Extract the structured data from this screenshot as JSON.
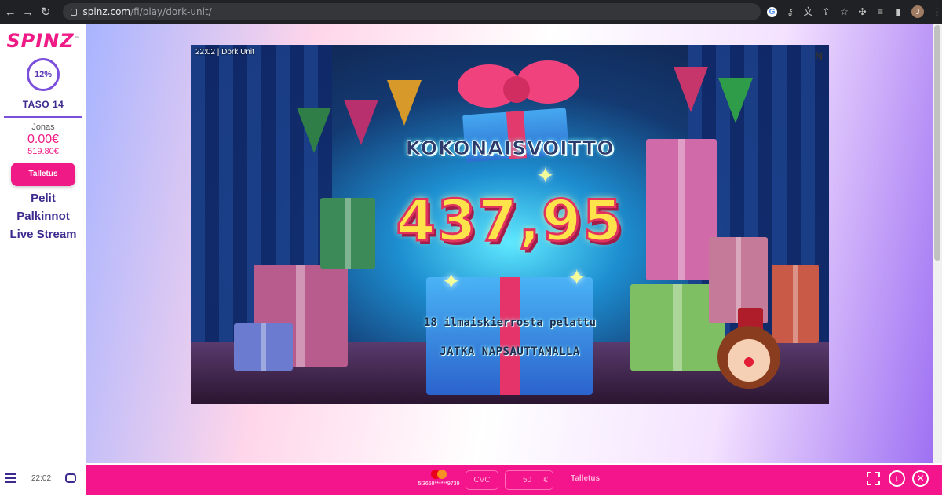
{
  "browser": {
    "url_host": "spinz.com",
    "url_path": "/fi/play/dork-unit/",
    "profile_initial": "J"
  },
  "sidebar": {
    "logo": "SPINZ",
    "logo_tm": "™",
    "level_percent": "12%",
    "level_label": "TASO 14",
    "user_name": "Jonas",
    "balance": "0.00€",
    "bonus_balance": "519.80€",
    "deposit_label": "Talletus",
    "menu": [
      {
        "label": "Pelit"
      },
      {
        "label": "Palkinnot"
      },
      {
        "label": "Live Stream"
      }
    ]
  },
  "game": {
    "hud_time": "22:02 |  Dork Unit",
    "hud_logo": "N",
    "title": "KOKONAISVOITTO",
    "win_amount": "437,95",
    "spins_text": "18 ilmaiskierrosta pelattu",
    "continue_text": "JATKA NAPSAUTTAMALLA"
  },
  "bottom_bar": {
    "clock": "22:02",
    "card_number": "5l3658******9739",
    "cvc_placeholder": "CVC",
    "amount_value": "50",
    "currency": "€",
    "deposit_label": "Talletus"
  },
  "colors": {
    "brand_pink": "#f4148c",
    "brand_purple": "#3e2a8f",
    "win_yellow": "#ffe34a"
  },
  "icons": [
    "back-arrow-icon",
    "forward-arrow-icon",
    "reload-icon",
    "lock-icon",
    "google-icon",
    "key-icon",
    "translate-icon",
    "share-icon",
    "star-icon",
    "puzzle-icon",
    "reading-list-icon",
    "sidebar-icon",
    "menu-icon",
    "chat-icon",
    "mastercard-icon",
    "fullscreen-icon",
    "download-icon",
    "close-icon"
  ]
}
